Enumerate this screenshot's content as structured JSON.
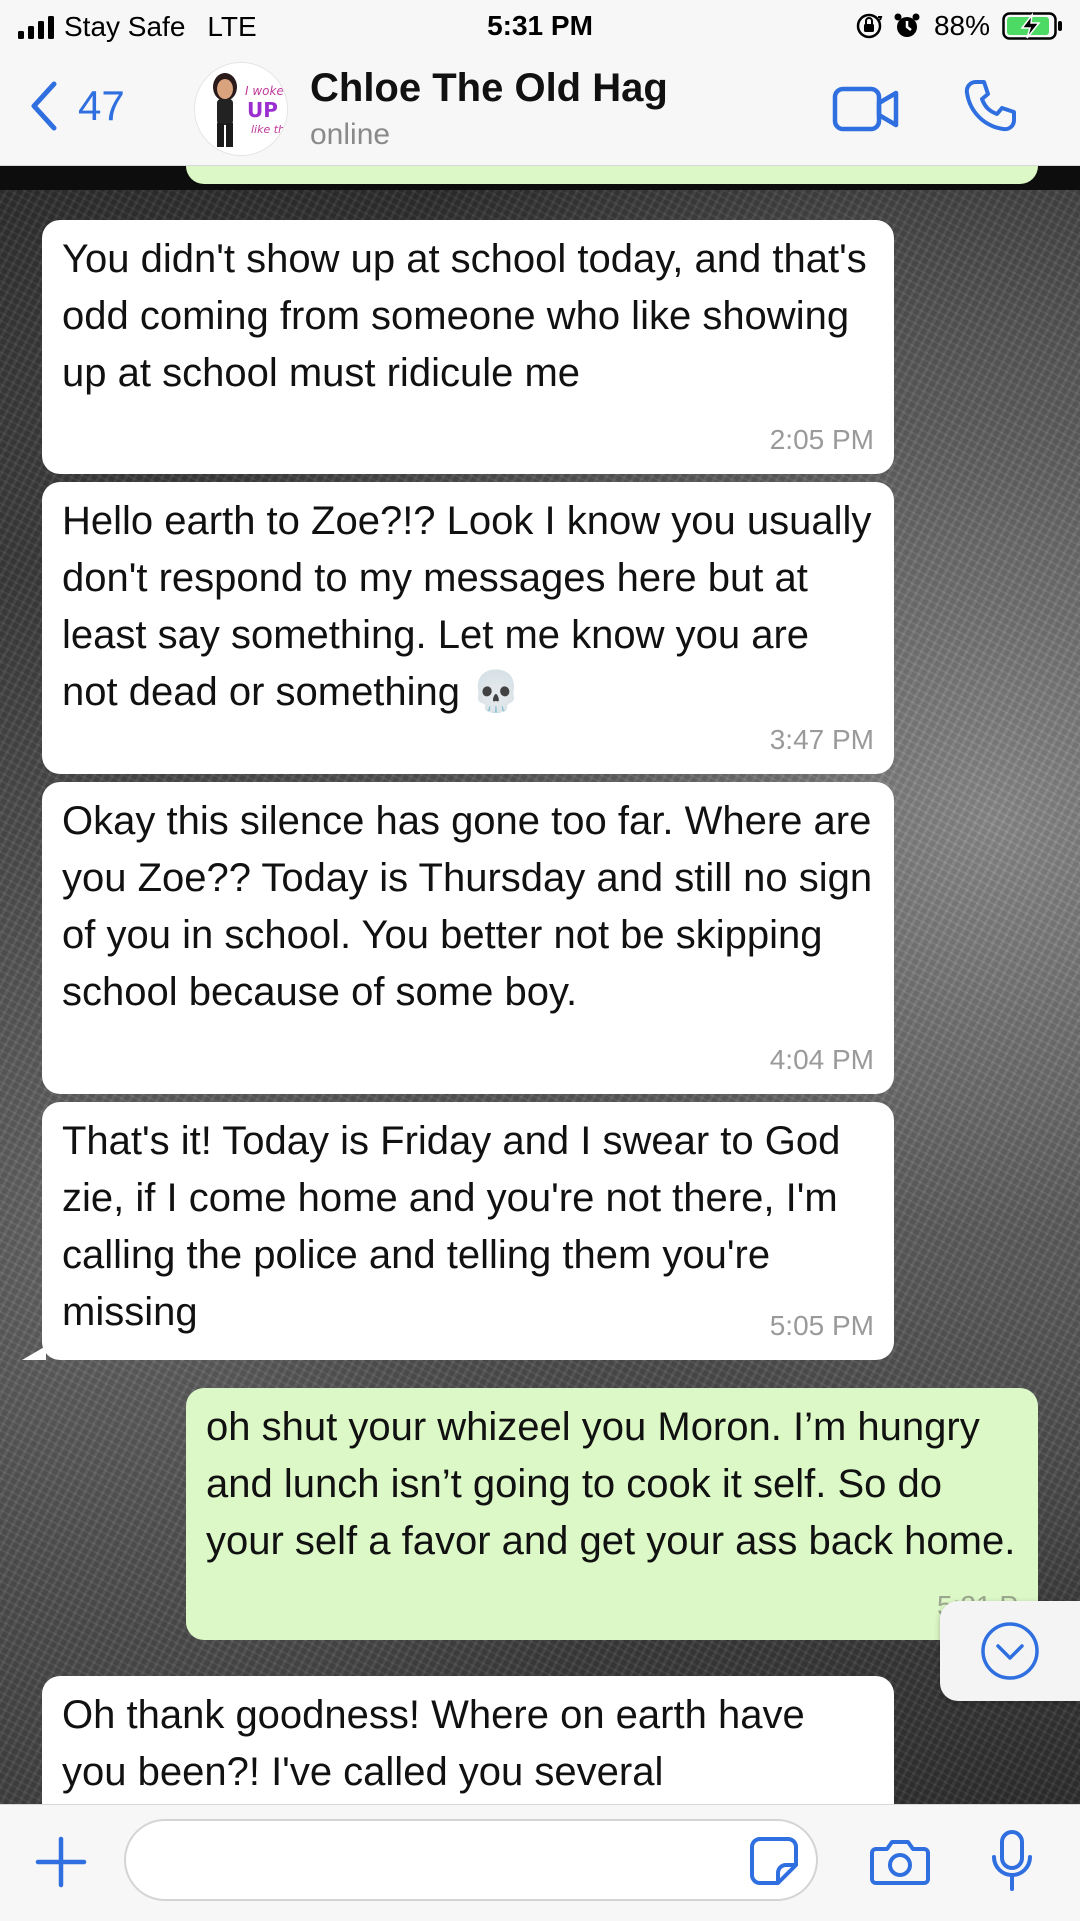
{
  "status_bar": {
    "carrier": "Stay Safe",
    "network": "LTE",
    "time": "5:31 PM",
    "battery": "88%",
    "icons": [
      "signal-bars-icon",
      "orientation-lock-icon",
      "alarm-icon",
      "battery-charging-icon"
    ]
  },
  "header": {
    "back_count": "47",
    "contact_name": "Chloe The Old Hag",
    "contact_status": "online",
    "avatar_sticker_text": "I woke UP like this",
    "actions": [
      "video-call-icon",
      "phone-call-icon"
    ]
  },
  "messages": [
    {
      "direction": "in",
      "text": "You didn't show up at school today, and that's odd coming from someone who like showing up at school must ridicule me",
      "time": "2:05 PM"
    },
    {
      "direction": "in",
      "text": "Hello earth to Zoe?!? Look I know you usually don't respond to my messages here but at least say something. Let me know you are not dead or something 💀",
      "time": "3:47 PM"
    },
    {
      "direction": "in",
      "text": "Okay this silence has gone too far. Where are you Zoe?? Today is Thursday and still no sign of you in school. You better not be skipping school because of some boy.",
      "time": "4:04 PM"
    },
    {
      "direction": "in",
      "text": "That's it! Today is Friday and I swear to God zie, if I come home and you're not there, I'm calling the police and telling them you're missing",
      "time": "5:05 PM"
    },
    {
      "direction": "out",
      "text": "oh shut your whizeel you Moron. I’m hungry and lunch isn’t going to cook it self. So do your self a favor and get your ass back home.",
      "time": "5:21 P"
    },
    {
      "direction": "in",
      "text": "Oh thank goodness! Where on earth have you been?! I've called you several",
      "time": ""
    }
  ],
  "composer": {
    "input_value": "",
    "icons": [
      "plus-icon",
      "sticker-icon",
      "camera-icon",
      "microphone-icon"
    ]
  },
  "colors": {
    "accent": "#2f6fe0",
    "incoming_bubble": "#ffffff",
    "outgoing_bubble": "#dcf8c6",
    "battery_fill": "#4cd964"
  }
}
